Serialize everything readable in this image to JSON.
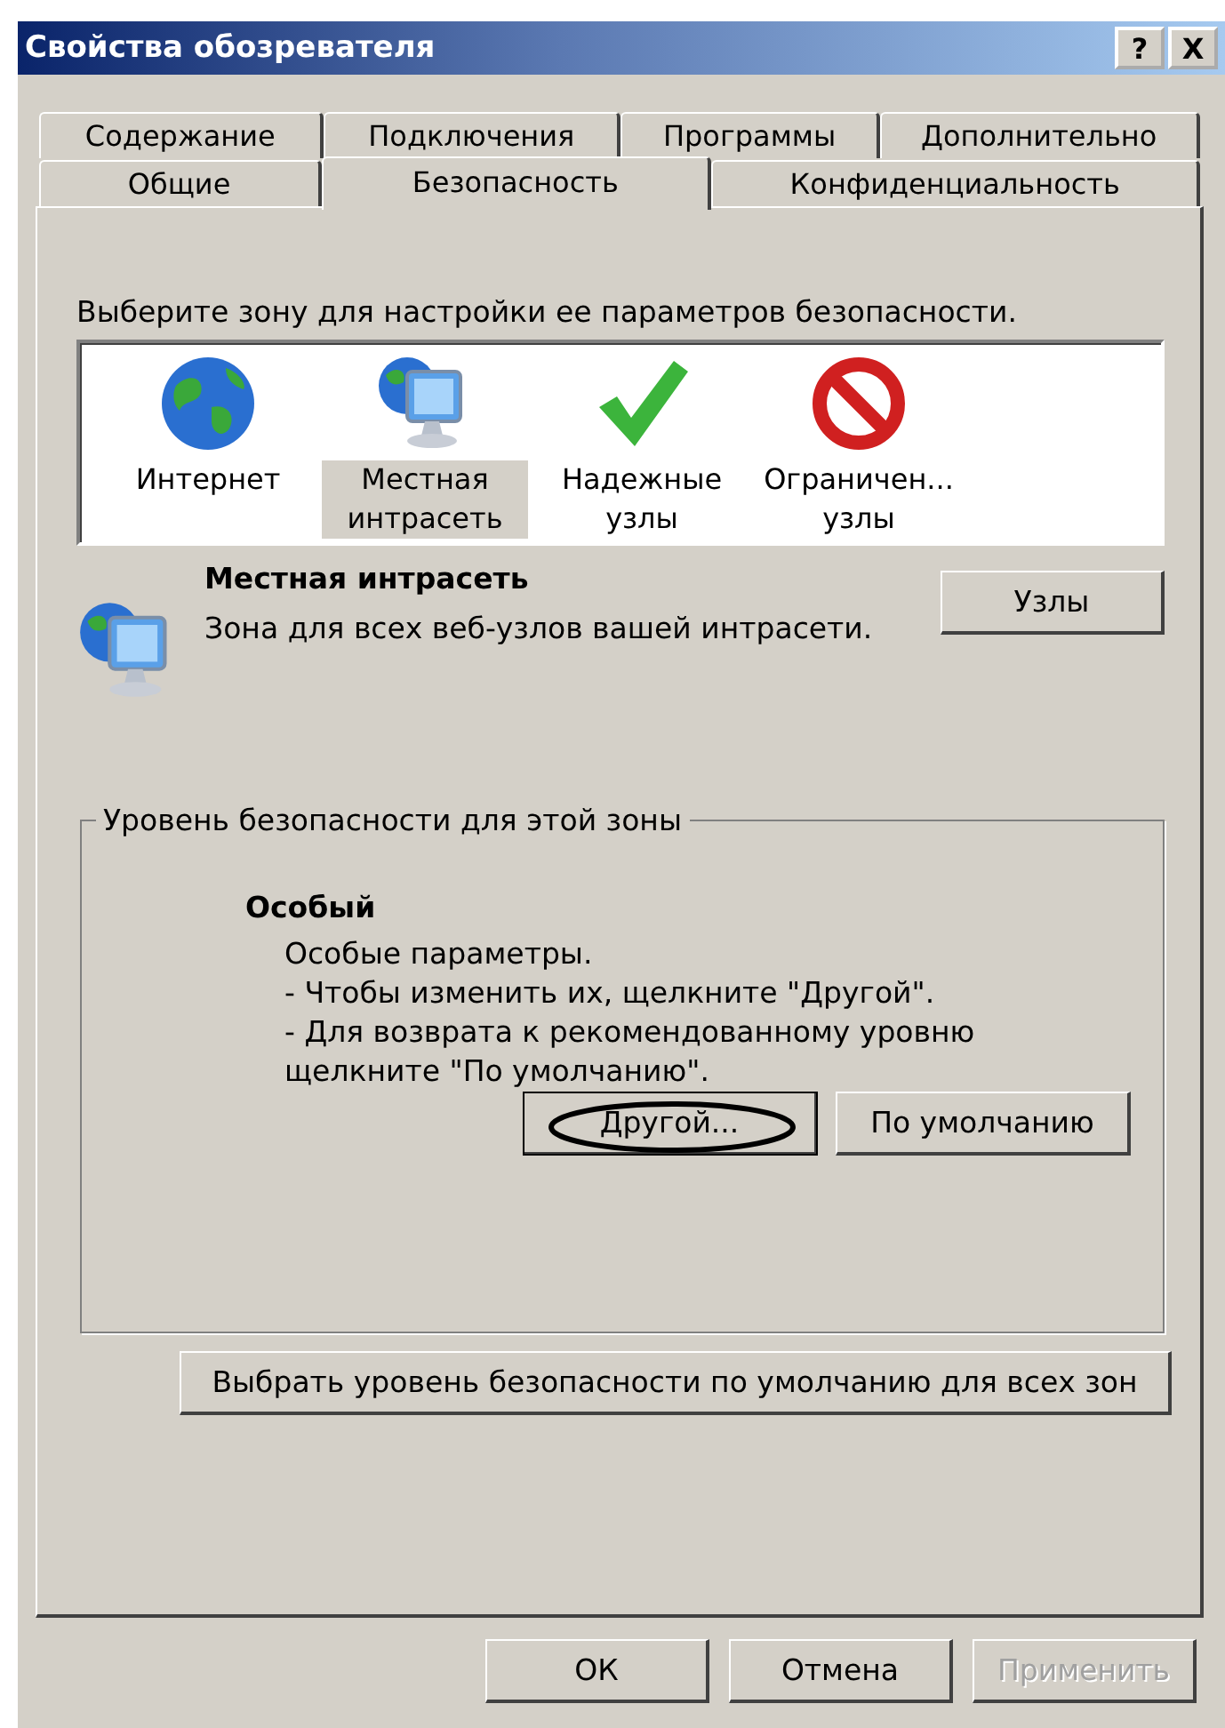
{
  "window": {
    "title": "Свойства обозревателя",
    "title_buttons": [
      "?",
      "X"
    ]
  },
  "tab_rows": [
    [
      {
        "label": "Содержание",
        "selected": false
      },
      {
        "label": "Подключения",
        "selected": false
      },
      {
        "label": "Программы",
        "selected": false
      },
      {
        "label": "Дополнительно",
        "selected": false
      }
    ],
    [
      {
        "label": "Общие",
        "selected": false
      },
      {
        "label": "Безопасность",
        "selected": true
      },
      {
        "label": "Конфиденциальность",
        "selected": false
      }
    ]
  ],
  "zone_prompt": "Выберите зону для настройки ее параметров безопасности.",
  "zones": [
    {
      "kind": "internet",
      "label": "Интернет",
      "selected": false
    },
    {
      "kind": "intranet",
      "label": "Местная интрасеть",
      "selected": true
    },
    {
      "kind": "trusted",
      "label": "Надежные узлы",
      "selected": false
    },
    {
      "kind": "restricted",
      "label": "Ограничен... узлы",
      "selected": false
    }
  ],
  "zone_info": {
    "title": "Местная интрасеть",
    "description": "Зона для всех веб-узлов вашей интрасети.",
    "button": "Узлы"
  },
  "security_level": {
    "legend": "Уровень безопасности для этой зоны",
    "level_name": "Особый",
    "lines": [
      "Особые параметры.",
      "- Чтобы изменить их, щелкните \"Другой\".",
      "- Для возврата к рекомендованному уровню щелкните \"По умолчанию\"."
    ],
    "buttons": [
      {
        "label": "Другой...",
        "focused": true
      },
      {
        "label": "По умолчанию",
        "focused": false
      }
    ]
  },
  "reset_all_button": "Выбрать уровень безопасности по умолчанию для всех зон",
  "dialog_buttons": [
    {
      "label": "ОК",
      "disabled": false
    },
    {
      "label": "Отмена",
      "disabled": false
    },
    {
      "label": "Применить",
      "disabled": true
    }
  ]
}
